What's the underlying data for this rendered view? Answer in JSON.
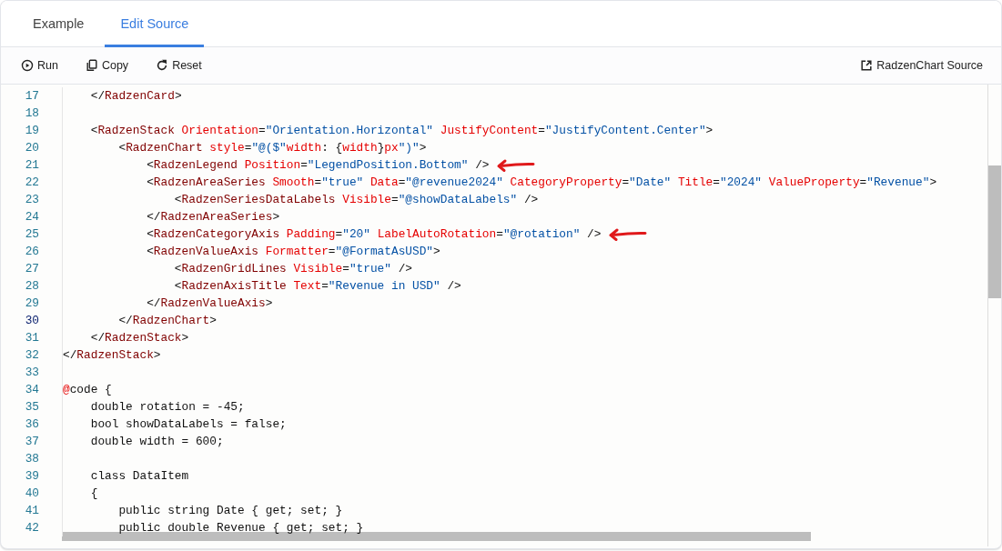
{
  "tabs": [
    {
      "label": "Example",
      "selected": false
    },
    {
      "label": "Edit Source",
      "selected": true
    }
  ],
  "toolbar": {
    "left": [
      {
        "kind": "run",
        "label": "Run"
      },
      {
        "kind": "copy",
        "label": "Copy"
      },
      {
        "kind": "reset",
        "label": "Reset"
      }
    ],
    "right": [
      {
        "kind": "source",
        "label": "RadzenChart Source"
      }
    ]
  },
  "editor": {
    "lines": [
      {
        "number": "17",
        "current": false,
        "arrow": false,
        "tokens": [
          {
            "kind": "punct",
            "text": "    </"
          },
          {
            "kind": "tag",
            "text": "RadzenCard"
          },
          {
            "kind": "punct",
            "text": ">"
          }
        ]
      },
      {
        "number": "18",
        "current": false,
        "arrow": false
      },
      {
        "number": "19",
        "current": false,
        "arrow": false,
        "tokens": [
          {
            "kind": "punct",
            "text": "    <"
          },
          {
            "kind": "tag",
            "text": "RadzenStack "
          },
          {
            "kind": "attr",
            "text": "Orientation"
          },
          {
            "kind": "punct",
            "text": "="
          },
          {
            "kind": "str",
            "text": "\"Orientation.Horizontal\" "
          },
          {
            "kind": "attr",
            "text": "JustifyContent"
          },
          {
            "kind": "punct",
            "text": "="
          },
          {
            "kind": "str",
            "text": "\"JustifyContent.Center\""
          },
          {
            "kind": "punct",
            "text": ">"
          }
        ]
      },
      {
        "number": "20",
        "current": false,
        "arrow": false,
        "tokens": [
          {
            "kind": "punct",
            "text": "        <"
          },
          {
            "kind": "tag",
            "text": "RadzenChart "
          },
          {
            "kind": "attr",
            "text": "style"
          },
          {
            "kind": "punct",
            "text": "="
          },
          {
            "kind": "str",
            "text": "\"@($\""
          },
          {
            "kind": "attr",
            "text": "width"
          },
          {
            "kind": "punct",
            "text": ": {"
          },
          {
            "kind": "attr",
            "text": "width"
          },
          {
            "kind": "punct",
            "text": "}"
          },
          {
            "kind": "attr",
            "text": "px"
          },
          {
            "kind": "str",
            "text": "\")\""
          },
          {
            "kind": "punct",
            "text": ">"
          }
        ]
      },
      {
        "number": "21",
        "current": false,
        "arrow": true,
        "tokens": [
          {
            "kind": "punct",
            "text": "            <"
          },
          {
            "kind": "tag",
            "text": "RadzenLegend "
          },
          {
            "kind": "attr",
            "text": "Position"
          },
          {
            "kind": "punct",
            "text": "="
          },
          {
            "kind": "str",
            "text": "\"LegendPosition.Bottom\" "
          },
          {
            "kind": "punct",
            "text": "/>"
          }
        ]
      },
      {
        "number": "22",
        "current": false,
        "arrow": false,
        "tokens": [
          {
            "kind": "punct",
            "text": "            <"
          },
          {
            "kind": "tag",
            "text": "RadzenAreaSeries "
          },
          {
            "kind": "attr",
            "text": "Smooth"
          },
          {
            "kind": "punct",
            "text": "="
          },
          {
            "kind": "str",
            "text": "\"true\" "
          },
          {
            "kind": "attr",
            "text": "Data"
          },
          {
            "kind": "punct",
            "text": "="
          },
          {
            "kind": "str",
            "text": "\"@revenue2024\" "
          },
          {
            "kind": "attr",
            "text": "CategoryProperty"
          },
          {
            "kind": "punct",
            "text": "="
          },
          {
            "kind": "str",
            "text": "\"Date\" "
          },
          {
            "kind": "attr",
            "text": "Title"
          },
          {
            "kind": "punct",
            "text": "="
          },
          {
            "kind": "str",
            "text": "\"2024\" "
          },
          {
            "kind": "attr",
            "text": "ValueProperty"
          },
          {
            "kind": "punct",
            "text": "="
          },
          {
            "kind": "str",
            "text": "\"Revenue\""
          },
          {
            "kind": "punct",
            "text": ">"
          }
        ]
      },
      {
        "number": "23",
        "current": false,
        "arrow": false,
        "tokens": [
          {
            "kind": "punct",
            "text": "                <"
          },
          {
            "kind": "tag",
            "text": "RadzenSeriesDataLabels "
          },
          {
            "kind": "attr",
            "text": "Visible"
          },
          {
            "kind": "punct",
            "text": "="
          },
          {
            "kind": "str",
            "text": "\"@showDataLabels\" "
          },
          {
            "kind": "punct",
            "text": "/>"
          }
        ]
      },
      {
        "number": "24",
        "current": false,
        "arrow": false,
        "tokens": [
          {
            "kind": "punct",
            "text": "            </"
          },
          {
            "kind": "tag",
            "text": "RadzenAreaSeries"
          },
          {
            "kind": "punct",
            "text": ">"
          }
        ]
      },
      {
        "number": "25",
        "current": false,
        "arrow": true,
        "tokens": [
          {
            "kind": "punct",
            "text": "            <"
          },
          {
            "kind": "tag",
            "text": "RadzenCategoryAxis "
          },
          {
            "kind": "attr",
            "text": "Padding"
          },
          {
            "kind": "punct",
            "text": "="
          },
          {
            "kind": "str",
            "text": "\"20\" "
          },
          {
            "kind": "attr",
            "text": "LabelAutoRotation"
          },
          {
            "kind": "punct",
            "text": "="
          },
          {
            "kind": "str",
            "text": "\"@rotation\" "
          },
          {
            "kind": "punct",
            "text": "/>"
          }
        ]
      },
      {
        "number": "26",
        "current": false,
        "arrow": false,
        "tokens": [
          {
            "kind": "punct",
            "text": "            <"
          },
          {
            "kind": "tag",
            "text": "RadzenValueAxis "
          },
          {
            "kind": "attr",
            "text": "Formatter"
          },
          {
            "kind": "punct",
            "text": "="
          },
          {
            "kind": "str",
            "text": "\"@FormatAsUSD\""
          },
          {
            "kind": "punct",
            "text": ">"
          }
        ]
      },
      {
        "number": "27",
        "current": false,
        "arrow": false,
        "tokens": [
          {
            "kind": "punct",
            "text": "                <"
          },
          {
            "kind": "tag",
            "text": "RadzenGridLines "
          },
          {
            "kind": "attr",
            "text": "Visible"
          },
          {
            "kind": "punct",
            "text": "="
          },
          {
            "kind": "str",
            "text": "\"true\" "
          },
          {
            "kind": "punct",
            "text": "/>"
          }
        ]
      },
      {
        "number": "28",
        "current": false,
        "arrow": false,
        "tokens": [
          {
            "kind": "punct",
            "text": "                <"
          },
          {
            "kind": "tag",
            "text": "RadzenAxisTitle "
          },
          {
            "kind": "attr",
            "text": "Text"
          },
          {
            "kind": "punct",
            "text": "="
          },
          {
            "kind": "str",
            "text": "\"Revenue in USD\" "
          },
          {
            "kind": "punct",
            "text": "/>"
          }
        ]
      },
      {
        "number": "29",
        "current": false,
        "arrow": false,
        "tokens": [
          {
            "kind": "punct",
            "text": "            </"
          },
          {
            "kind": "tag",
            "text": "RadzenValueAxis"
          },
          {
            "kind": "punct",
            "text": ">"
          }
        ]
      },
      {
        "number": "30",
        "current": true,
        "arrow": false,
        "tokens": [
          {
            "kind": "punct",
            "text": "        </"
          },
          {
            "kind": "tag",
            "text": "RadzenChart"
          },
          {
            "kind": "punct",
            "text": ">"
          }
        ]
      },
      {
        "number": "31",
        "current": false,
        "arrow": false,
        "tokens": [
          {
            "kind": "punct",
            "text": "    </"
          },
          {
            "kind": "tag",
            "text": "RadzenStack"
          },
          {
            "kind": "punct",
            "text": ">"
          }
        ]
      },
      {
        "number": "32",
        "current": false,
        "arrow": false,
        "tokens": [
          {
            "kind": "punct",
            "text": "</"
          },
          {
            "kind": "tag",
            "text": "RadzenStack"
          },
          {
            "kind": "punct",
            "text": ">"
          }
        ]
      },
      {
        "number": "33",
        "current": false,
        "arrow": false
      },
      {
        "number": "34",
        "current": false,
        "arrow": false,
        "tokens": [
          {
            "kind": "attr",
            "text": "@"
          },
          {
            "kind": "punct",
            "text": "code {"
          }
        ]
      },
      {
        "number": "35",
        "current": false,
        "arrow": false,
        "tokens": [
          {
            "kind": "punct",
            "text": "    double rotation = -45;"
          }
        ]
      },
      {
        "number": "36",
        "current": false,
        "arrow": false,
        "tokens": [
          {
            "kind": "punct",
            "text": "    bool showDataLabels = false;"
          }
        ]
      },
      {
        "number": "37",
        "current": false,
        "arrow": false,
        "tokens": [
          {
            "kind": "punct",
            "text": "    double width = 600;"
          }
        ]
      },
      {
        "number": "38",
        "current": false,
        "arrow": false
      },
      {
        "number": "39",
        "current": false,
        "arrow": false,
        "tokens": [
          {
            "kind": "punct",
            "text": "    class DataItem"
          }
        ]
      },
      {
        "number": "40",
        "current": false,
        "arrow": false,
        "tokens": [
          {
            "kind": "punct",
            "text": "    {"
          }
        ]
      },
      {
        "number": "41",
        "current": false,
        "arrow": false,
        "tokens": [
          {
            "kind": "punct",
            "text": "        public string Date { get; set; }"
          }
        ]
      },
      {
        "number": "42",
        "current": false,
        "arrow": false,
        "tokens": [
          {
            "kind": "punct",
            "text": "        public double Revenue { get; set; }"
          }
        ]
      }
    ]
  }
}
